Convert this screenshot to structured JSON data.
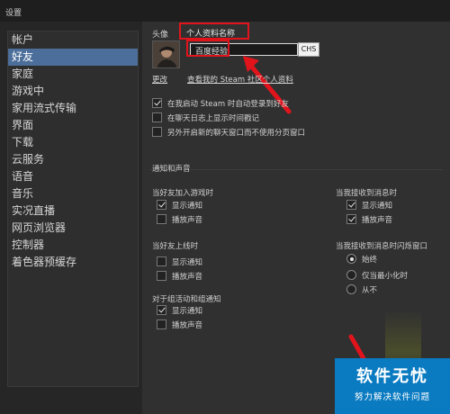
{
  "window": {
    "title": "设置"
  },
  "sidebar": {
    "items": [
      {
        "label": "帐户",
        "active": false
      },
      {
        "label": "好友",
        "active": true
      },
      {
        "label": "家庭",
        "active": false
      },
      {
        "label": "游戏中",
        "active": false
      },
      {
        "label": "家用流式传输",
        "active": false
      },
      {
        "label": "界面",
        "active": false
      },
      {
        "label": "下载",
        "active": false
      },
      {
        "label": "云服务",
        "active": false
      },
      {
        "label": "语音",
        "active": false
      },
      {
        "label": "音乐",
        "active": false
      },
      {
        "label": "实况直播",
        "active": false
      },
      {
        "label": "网页浏览器",
        "active": false
      },
      {
        "label": "控制器",
        "active": false
      },
      {
        "label": "着色器预缓存",
        "active": false
      }
    ]
  },
  "profile": {
    "avatar_label": "头像",
    "name_title": "个人资料名称",
    "name_value": "百度经验",
    "lang_button": "CHS",
    "change_link": "更改",
    "view_profile_link": "查看我的 Steam 社区个人资料"
  },
  "options": [
    {
      "label": "在我启动 Steam 时自动登录到好友",
      "checked": true
    },
    {
      "label": "在聊天日志上显示时间戳记",
      "checked": false
    },
    {
      "label": "另外开启新的聊天窗口而不使用分页窗口",
      "checked": false
    }
  ],
  "notifications": {
    "heading": "通知和声音",
    "friend_joins_game": {
      "title": "当好友加入游戏时",
      "show_notification": {
        "label": "显示通知",
        "checked": true
      },
      "play_sound": {
        "label": "播放声音",
        "checked": false
      }
    },
    "friend_online": {
      "title": "当好友上线时",
      "show_notification": {
        "label": "显示通知",
        "checked": false
      },
      "play_sound": {
        "label": "播放声音",
        "checked": false
      }
    },
    "group_event": {
      "title": "对于组活动和组通知",
      "show_notification": {
        "label": "显示通知",
        "checked": true
      },
      "play_sound": {
        "label": "播放声音",
        "checked": false
      }
    },
    "message_received": {
      "title": "当我接收到消息时",
      "show_notification": {
        "label": "显示通知",
        "checked": true
      },
      "play_sound": {
        "label": "播放声音",
        "checked": true
      }
    },
    "flash_window": {
      "title": "当我接收到消息时闪烁窗口",
      "options": [
        {
          "label": "始终",
          "selected": true
        },
        {
          "label": "仅当最小化时",
          "selected": false
        },
        {
          "label": "从不",
          "selected": false
        }
      ]
    }
  },
  "watermark": {
    "title": "软件无忧",
    "subtitle": "努力解决软件问题"
  },
  "colors": {
    "accent": "#4b6e9a",
    "highlight": "#e1141c",
    "watermark": "#0b7bc1"
  }
}
